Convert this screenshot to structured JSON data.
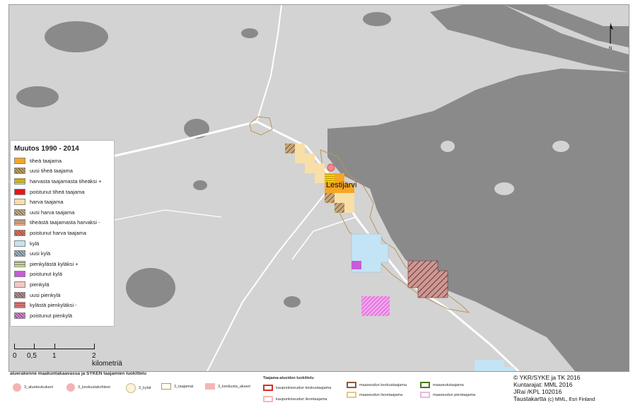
{
  "map": {
    "place_label": "Lestijärvi",
    "colors": {
      "land": "#d3d3d3",
      "water": "#8a8a8a",
      "road": "#ffffff"
    }
  },
  "legend": {
    "title": "Muutos 1990 - 2014",
    "items": [
      {
        "label": "tiheä taajama",
        "color": "#f5a623",
        "pattern": "solid"
      },
      {
        "label": "uusi tiheä taajama",
        "color": "#c8a15a",
        "pattern": "hatch"
      },
      {
        "label": "harvasta taajamasta tiheäksi +",
        "color": "#f6d400",
        "pattern": "hlines"
      },
      {
        "label": "poistunut tiheä taajama",
        "color": "#e8141b",
        "pattern": "solid"
      },
      {
        "label": "harva taajama",
        "color": "#f8dfa8",
        "pattern": "solid"
      },
      {
        "label": "uusi harva taajama",
        "color": "#c9b18a",
        "pattern": "hatch"
      },
      {
        "label": "tiheästä taajamasta harvaksi -",
        "color": "#f1b08a",
        "pattern": "hlines"
      },
      {
        "label": "poistunut harva taajama",
        "color": "#ef6a4a",
        "pattern": "hatch"
      },
      {
        "label": "kylä",
        "color": "#c3e4f5",
        "pattern": "solid"
      },
      {
        "label": "uusi kylä",
        "color": "#9fb8c8",
        "pattern": "hatch"
      },
      {
        "label": "pienkylästä kyläksi +",
        "color": "#d7e88a",
        "pattern": "hlines"
      },
      {
        "label": "poistunut kylä",
        "color": "#c75bd9",
        "pattern": "solid"
      },
      {
        "label": "pienkylä",
        "color": "#f6c6c6",
        "pattern": "solid"
      },
      {
        "label": "uusi pienkylä",
        "color": "#b88c8c",
        "pattern": "hatch"
      },
      {
        "label": "kylästä pienkyläksi -",
        "color": "#e57777",
        "pattern": "hlines"
      },
      {
        "label": "poistunut pienkylä",
        "color": "#e377e0",
        "pattern": "hatch"
      }
    ]
  },
  "scale": {
    "labels": [
      "0",
      "0,5",
      "1",
      "2 kilometriä"
    ]
  },
  "north_label": "N",
  "bottom_legend": {
    "heading": "aluerakenne maakuntakaavassa ja SYKEN taajamien luokittelu",
    "items": [
      {
        "label": "3_aluekeskukset",
        "color": "#f3b3b3",
        "kind": "circle"
      },
      {
        "label": "3_keskustakohteet",
        "color": "#f3b3b3",
        "kind": "circle"
      },
      {
        "label": "3_kylat",
        "color": "#fbf3dc",
        "kind": "circle"
      },
      {
        "label": "3_taajamat",
        "color": "#ffffff",
        "kind": "box"
      },
      {
        "label": "3_keskusta_alueet",
        "color": "#f4b6b6",
        "kind": "box"
      }
    ],
    "taajama_heading": "Taajama-alueiden luokittelu",
    "taajama_items": [
      {
        "label": "kaupunkiseudun keskustaajama",
        "color": "#d92b2b"
      },
      {
        "label": "kaupunkiseudun lievetaajama",
        "color": "#f2b8b8"
      },
      {
        "label": "maaseudun keskustaajama",
        "color": "#8a5a44"
      },
      {
        "label": "maaseudun lievetaajama",
        "color": "#e9c58a"
      },
      {
        "label": "maaseututaajama",
        "color": "#4a7a1f"
      },
      {
        "label": "maaseudun pientaajama",
        "color": "#e8b8e0"
      }
    ]
  },
  "credits": {
    "line1": "© YKR/SYKE ja TK 2016",
    "line2": "Kuntarajat: MML 2016",
    "line3": "JRai /KPL 102016",
    "line4a": "Taustakartta",
    "line4b": "(c) MML, Esri Finland"
  }
}
